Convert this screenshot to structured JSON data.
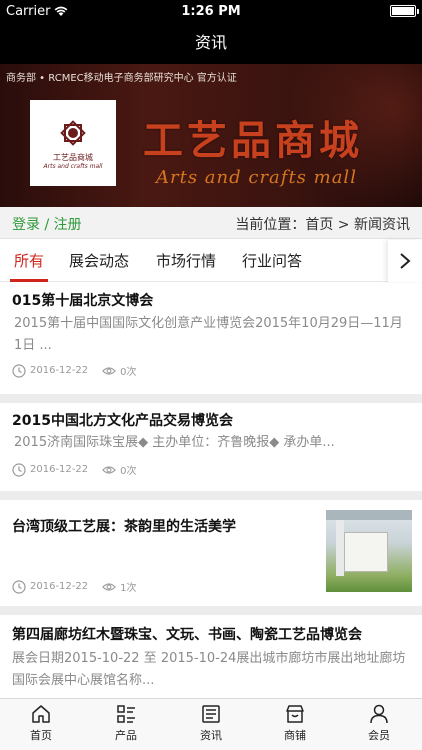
{
  "status": {
    "carrier": "Carrier",
    "time": "1:26 PM"
  },
  "nav": {
    "title": "资讯"
  },
  "banner": {
    "cert": "商务部 • RCMEC移动电子商务部研究中心  官方认证",
    "logo_name": "工艺品商城",
    "logo_sub": "Arts and crafts mall",
    "title": "工艺品商城",
    "subtitle": "Arts and crafts mall"
  },
  "crumb": {
    "login": "登录",
    "sep": " / ",
    "register": "注册",
    "location": "当前位置：首页 > 新闻资讯"
  },
  "tabs": [
    {
      "label": "所有",
      "active": true
    },
    {
      "label": "展会动态",
      "active": false
    },
    {
      "label": "市场行情",
      "active": false
    },
    {
      "label": "行业问答",
      "active": false
    }
  ],
  "items": [
    {
      "title": "015第十届北京文博会",
      "desc": "2015第十届中国国际文化创意产业博览会2015年10月29日—11月1日 ...",
      "date": "2016-12-22",
      "views": "0次"
    },
    {
      "title": "2015中国北方文化产品交易博览会",
      "desc": "2015济南国际珠宝展◆ 主办单位：齐鲁晚报◆ 承办单...",
      "date": "2016-12-22",
      "views": "0次"
    },
    {
      "title": "台湾顶级工艺展：茶韵里的生活美学",
      "desc": "",
      "date": "2016-12-22",
      "views": "1次"
    },
    {
      "title": "第四届廊坊红木暨珠宝、文玩、书画、陶瓷工艺品博览会",
      "desc": "展会日期2015-10-22 至 2015-10-24展出城市廊坊市展出地址廊坊国际会展中心展馆名称...",
      "date": "",
      "views": ""
    }
  ],
  "tabbar": [
    {
      "label": "首页",
      "icon": "home-icon"
    },
    {
      "label": "产品",
      "icon": "list-icon"
    },
    {
      "label": "资讯",
      "icon": "news-icon"
    },
    {
      "label": "商铺",
      "icon": "store-icon"
    },
    {
      "label": "会员",
      "icon": "user-icon"
    }
  ],
  "colors": {
    "accent": "#d0251d",
    "login_green": "#2e9a3a",
    "banner_bg": "#3a130f"
  }
}
